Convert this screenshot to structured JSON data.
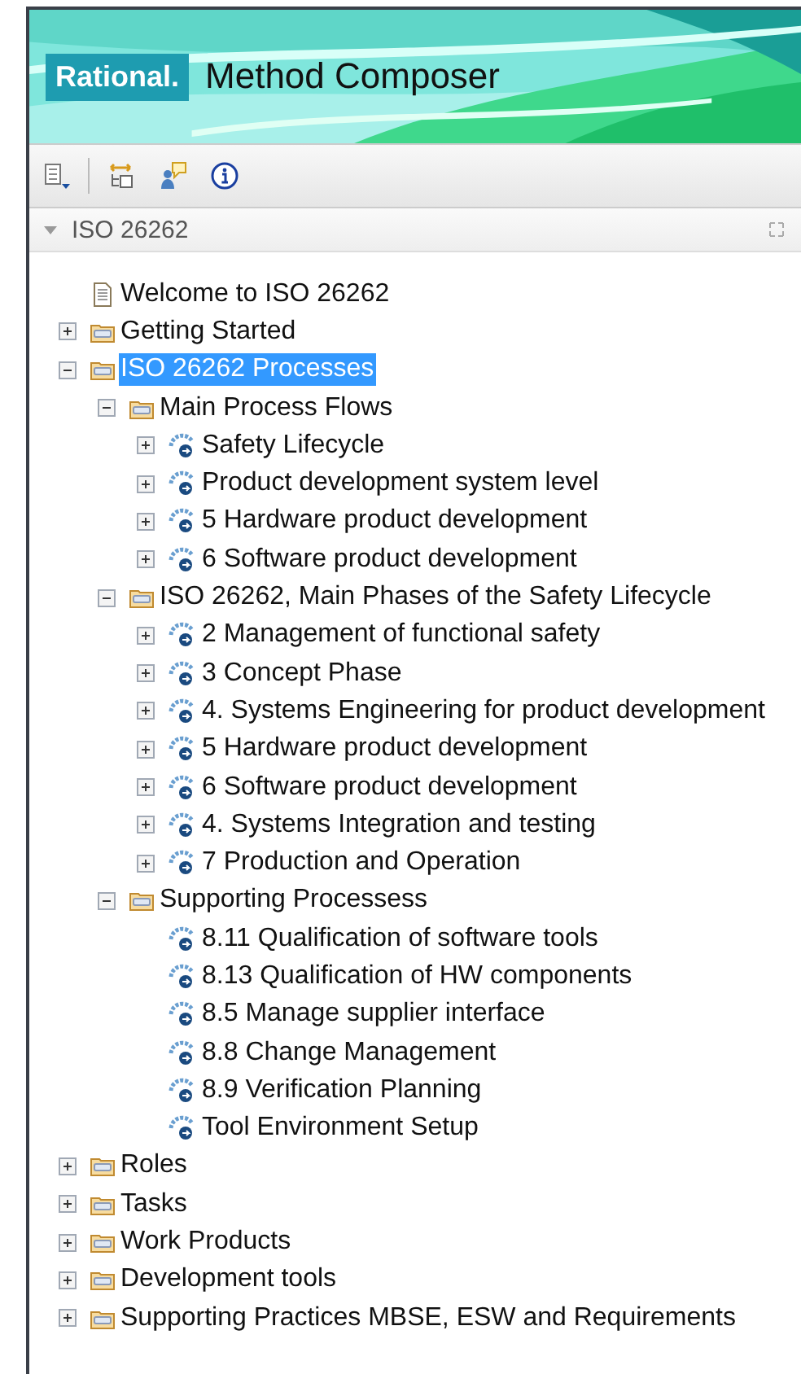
{
  "banner": {
    "logo": "Rational.",
    "title": "Method Composer"
  },
  "panel": {
    "title": "ISO 26262"
  },
  "tree": [
    {
      "label": "Welcome to ISO 26262",
      "kind": "page",
      "selected": false
    },
    {
      "label": "Getting Started",
      "kind": "folder",
      "expanded": false,
      "selected": false
    },
    {
      "label": "ISO 26262 Processes",
      "kind": "folder",
      "expanded": true,
      "selected": true,
      "children": [
        {
          "label": "Main Process Flows",
          "kind": "folder",
          "expanded": true,
          "selected": false,
          "children": [
            {
              "label": "Safety Lifecycle",
              "kind": "process",
              "expanded": false,
              "selected": false
            },
            {
              "label": "Product development system level",
              "kind": "process",
              "expanded": false,
              "selected": false
            },
            {
              "label": "5 Hardware product development",
              "kind": "process",
              "expanded": false,
              "selected": false
            },
            {
              "label": "6 Software product development",
              "kind": "process",
              "expanded": false,
              "selected": false
            }
          ]
        },
        {
          "label": "ISO 26262, Main Phases of the Safety Lifecycle",
          "kind": "folder",
          "expanded": true,
          "selected": false,
          "children": [
            {
              "label": "2 Management of functional safety",
              "kind": "process",
              "expanded": false,
              "selected": false
            },
            {
              "label": "3 Concept Phase",
              "kind": "process",
              "expanded": false,
              "selected": false
            },
            {
              "label": "4. Systems Engineering for product development",
              "kind": "process",
              "expanded": false,
              "selected": false
            },
            {
              "label": "5 Hardware product development",
              "kind": "process",
              "expanded": false,
              "selected": false
            },
            {
              "label": "6 Software product development",
              "kind": "process",
              "expanded": false,
              "selected": false
            },
            {
              "label": "4. Systems Integration and testing",
              "kind": "process",
              "expanded": false,
              "selected": false
            },
            {
              "label": "7 Production and Operation",
              "kind": "process",
              "expanded": false,
              "selected": false
            }
          ]
        },
        {
          "label": "Supporting Processess",
          "kind": "folder",
          "expanded": true,
          "selected": false,
          "children": [
            {
              "label": "8.11 Qualification of software tools",
              "kind": "process",
              "selected": false
            },
            {
              "label": "8.13 Qualification of HW components",
              "kind": "process",
              "selected": false
            },
            {
              "label": "8.5 Manage supplier interface",
              "kind": "process",
              "selected": false
            },
            {
              "label": "8.8 Change Management",
              "kind": "process",
              "selected": false
            },
            {
              "label": "8.9 Verification Planning",
              "kind": "process",
              "selected": false
            },
            {
              "label": "Tool Environment Setup",
              "kind": "process",
              "selected": false
            }
          ]
        }
      ]
    },
    {
      "label": "Roles",
      "kind": "folder",
      "expanded": false,
      "selected": false
    },
    {
      "label": "Tasks",
      "kind": "folder",
      "expanded": false,
      "selected": false
    },
    {
      "label": "Work Products",
      "kind": "folder",
      "expanded": false,
      "selected": false
    },
    {
      "label": "Development tools",
      "kind": "folder",
      "expanded": false,
      "selected": false
    },
    {
      "label": "Supporting Practices MBSE, ESW and Requirements",
      "kind": "folder",
      "expanded": false,
      "selected": false
    }
  ]
}
